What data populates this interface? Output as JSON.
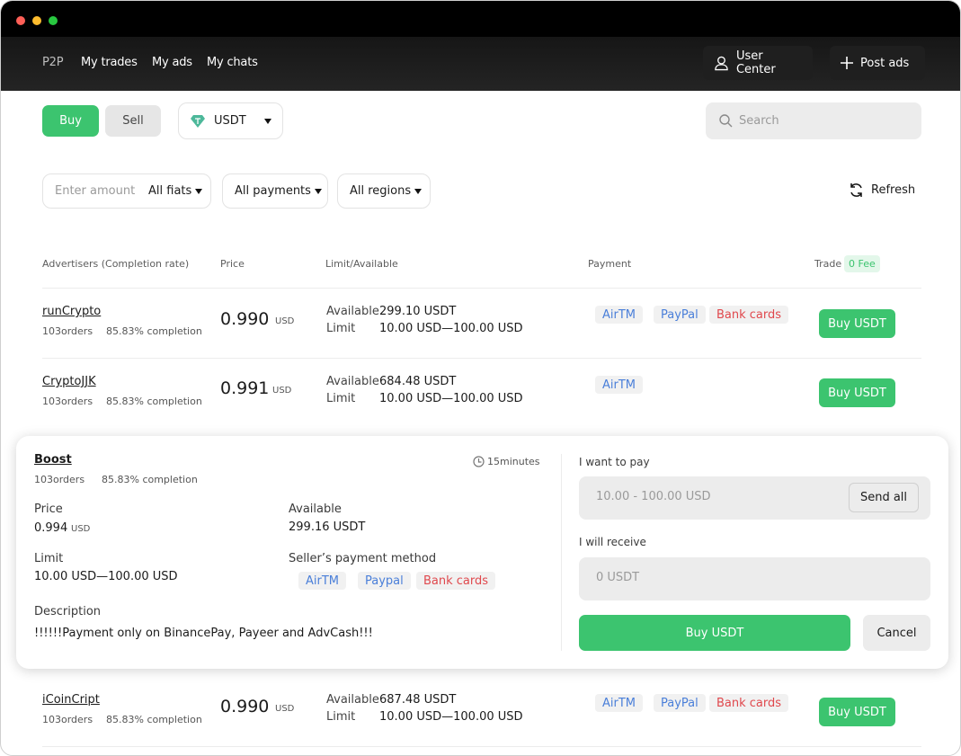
{
  "nav": {
    "p2p": "P2P",
    "my_trades": "My trades",
    "my_ads": "My ads",
    "my_chats": "My chats",
    "user_center": "User Center",
    "post_ads": "Post ads"
  },
  "toolbar": {
    "buy": "Buy",
    "sell": "Sell",
    "asset": "USDT",
    "search_placeholder": "Search"
  },
  "filters": {
    "amount_placeholder": "Enter amount",
    "fiats": "All fiats",
    "payments": "All payments",
    "regions": "All regions",
    "refresh": "Refresh"
  },
  "table": {
    "headers": {
      "advertisers": "Advertisers (Completion rate)",
      "price": "Price",
      "limit": "Limit/Available",
      "payment": "Payment",
      "trade": "Trade",
      "fee_badge": "0 Fee"
    },
    "labels": {
      "available": "Available",
      "limit": "Limit"
    },
    "rows": [
      {
        "name": "runCrypto",
        "orders": "103orders",
        "completion": "85.83% completion",
        "price": "0.990",
        "currency": "USD",
        "available": "299.10 USDT",
        "limit": "10.00 USD—100.00 USD",
        "payments": [
          "AirTM",
          "PayPal",
          "Bank cards"
        ],
        "button": "Buy USDT"
      },
      {
        "name": "CryptoJJK",
        "orders": "103orders",
        "completion": "85.83% completion",
        "price": "0.991",
        "currency": "USD",
        "available": "684.48 USDT",
        "limit": "10.00 USD—100.00 USD",
        "payments": [
          "AirTM"
        ],
        "button": "Buy USDT"
      },
      {
        "name": "iCoinCript",
        "orders": "103orders",
        "completion": "85.83% completion",
        "price": "0.990",
        "currency": "USD",
        "available": "687.48 USDT",
        "limit": "10.00 USD—100.00 USD",
        "payments": [
          "AirTM",
          "PayPal",
          "Bank cards"
        ],
        "button": "Buy USDT"
      }
    ]
  },
  "detail": {
    "name": "Boost",
    "orders": "103orders",
    "completion": "85.83% completion",
    "time": "15minutes",
    "price_label": "Price",
    "price": "0.994",
    "currency": "USD",
    "available_label": "Available",
    "available": "299.16 USDT",
    "limit_label": "Limit",
    "limit": "10.00 USD—100.00 USD",
    "method_label": "Seller’s payment method",
    "methods": [
      "AirTM",
      "Paypal",
      "Bank cards"
    ],
    "description_label": "Description",
    "description": "!!!!!!Payment only on BinancePay, Payeer and AdvCash!!!",
    "pay_label": "I want to pay",
    "pay_placeholder": "10.00 - 100.00 USD",
    "send_all": "Send all",
    "receive_label": "I will receive",
    "receive_placeholder": "0 USDT",
    "buy": "Buy USDT",
    "cancel": "Cancel"
  },
  "colors": {
    "green": "#3cc46f",
    "blue_tag": "#4a7fd9",
    "red_tag": "#e0484d"
  },
  "icons": [
    "user-icon",
    "plus-icon",
    "usdt-diamond-icon",
    "search-icon",
    "refresh-icon",
    "clock-icon"
  ]
}
